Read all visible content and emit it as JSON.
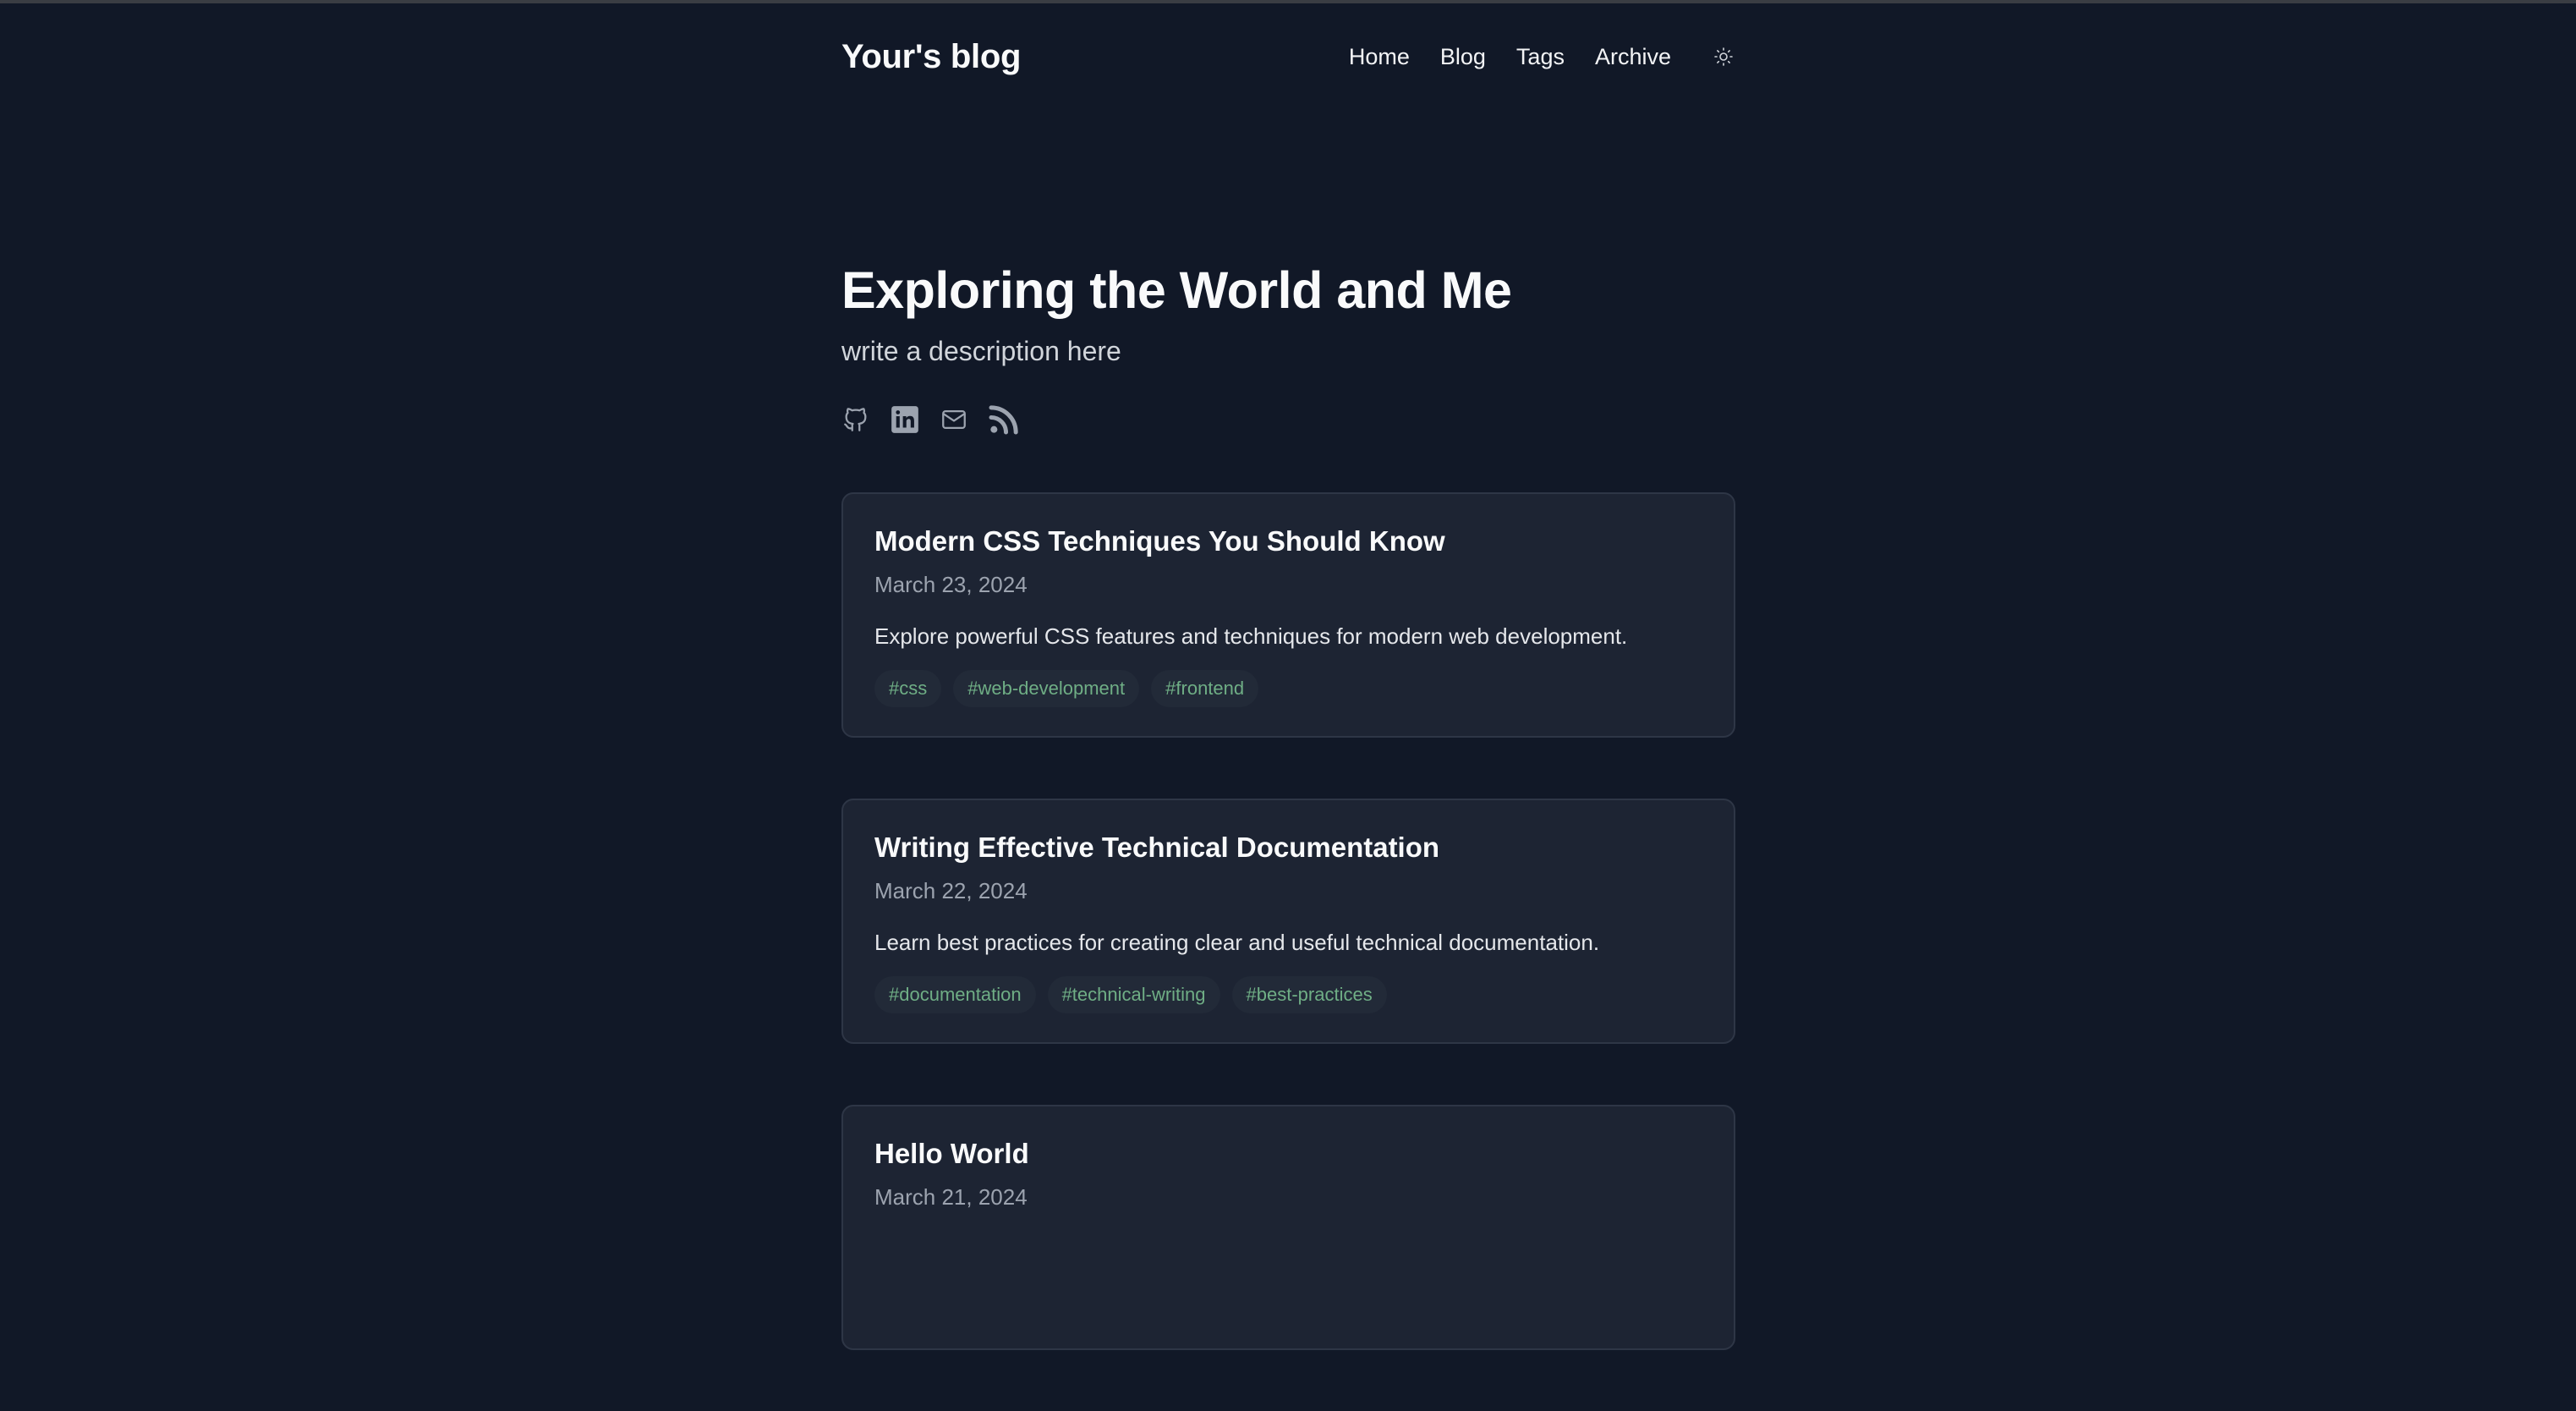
{
  "header": {
    "site_title": "Your's blog",
    "nav": [
      "Home",
      "Blog",
      "Tags",
      "Archive"
    ],
    "theme_toggle_icon": "sun-icon"
  },
  "hero": {
    "title": "Exploring the World and Me",
    "description": "write a description here",
    "socials": [
      "github-icon",
      "linkedin-icon",
      "mail-icon",
      "rss-icon"
    ]
  },
  "posts": [
    {
      "title": "Modern CSS Techniques You Should Know",
      "date": "March 23, 2024",
      "excerpt": "Explore powerful CSS features and techniques for modern web development.",
      "tags": [
        "#css",
        "#web-development",
        "#frontend"
      ]
    },
    {
      "title": "Writing Effective Technical Documentation",
      "date": "March 22, 2024",
      "excerpt": "Learn best practices for creating clear and useful technical documentation.",
      "tags": [
        "#documentation",
        "#technical-writing",
        "#best-practices"
      ]
    },
    {
      "title": "Hello World",
      "date": "March 21, 2024"
    }
  ],
  "colors": {
    "background": "#111827",
    "card": "#1d2433",
    "tag_text": "#6fae85"
  }
}
